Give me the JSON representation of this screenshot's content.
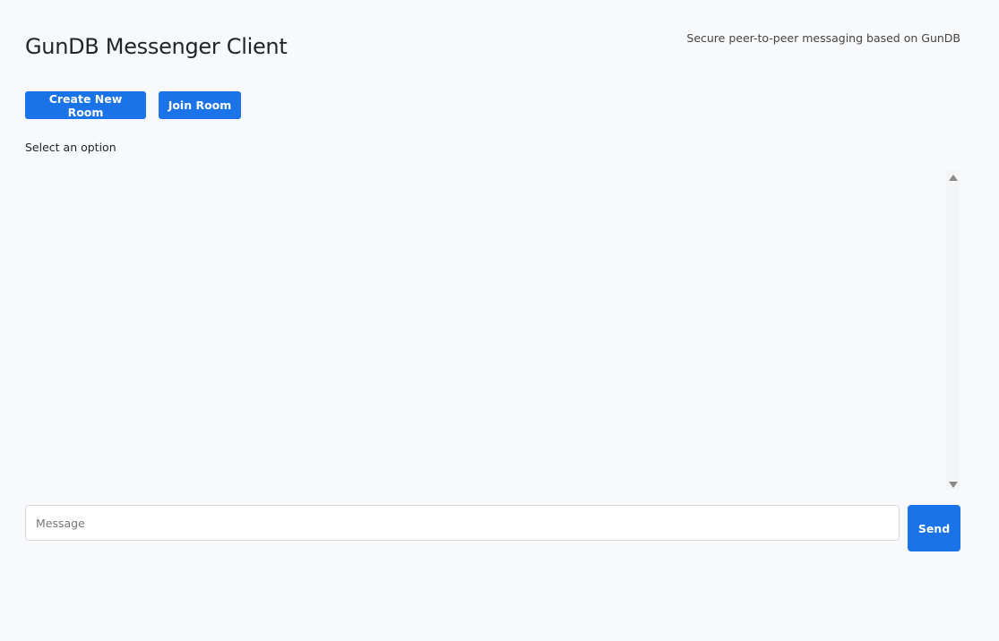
{
  "header": {
    "title": "GunDB Messenger Client",
    "tagline": "Secure peer-to-peer messaging based on GunDB"
  },
  "actions": {
    "create_label": "Create New Room",
    "join_label": "Join Room"
  },
  "status": "Select an option",
  "composer": {
    "placeholder": "Message",
    "value": "",
    "send_label": "Send"
  },
  "colors": {
    "accent": "#1a73e8",
    "background": "#f8f9fb"
  }
}
